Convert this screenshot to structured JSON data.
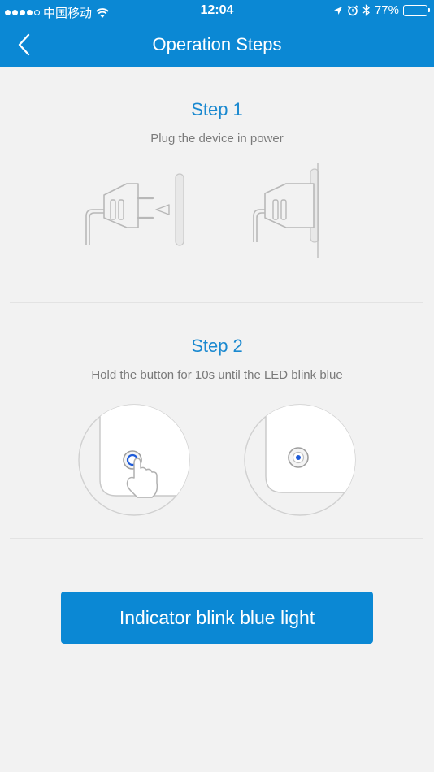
{
  "status_bar": {
    "carrier": "中国移动",
    "time": "12:04",
    "battery": "77%",
    "battery_level": 0.77
  },
  "nav": {
    "title": "Operation Steps"
  },
  "steps": [
    {
      "title": "Step 1",
      "description": "Plug the device in power"
    },
    {
      "title": "Step 2",
      "description": "Hold the button for 10s until the LED blink blue"
    }
  ],
  "confirm_button": {
    "label": "Indicator blink blue light"
  },
  "colors": {
    "primary": "#0b88d4",
    "step_title": "#1a89d0",
    "led_blue": "#1e5bd8"
  }
}
